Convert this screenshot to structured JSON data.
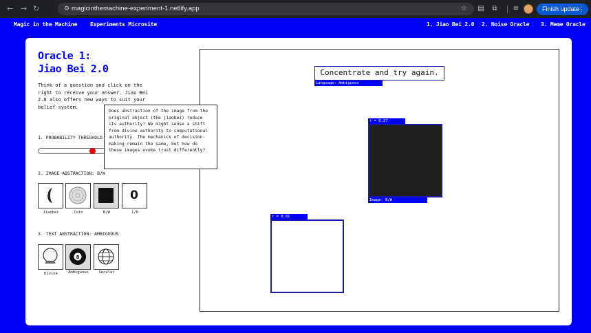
{
  "browser": {
    "url": "magicinthemachine-experiment-1.netlify.app",
    "update_button": "Finish update"
  },
  "site": {
    "brand": "Magic in the Machine",
    "subtitle": "Experiments Microsite",
    "nav": [
      "1. Jiao Bei 2.0",
      "2. Noise Oracle",
      "3. Meme Oracle"
    ]
  },
  "sidebar": {
    "title_line1": "Oracle 1:",
    "title_line2": "Jiao Bei 2.0",
    "intro": "Think of a question and click on the right to receive your answer. Jiao Bei 2.0 also offers new ways to suit your belief system.",
    "probability_label": "1. PROBABILITY THRESHOLD",
    "image_label": "2. IMAGE ABSTRACTION: B/W",
    "image_options": [
      "Jiaobei",
      "Coin",
      "B/W",
      "1/0"
    ],
    "image_option_glyph": "0",
    "text_label": "3. TEXT ABSTRACTION: AMBIGUOUS",
    "text_options": [
      "Divine",
      "Ambiguous",
      "Secular"
    ],
    "tooltip": "Does abstraction of the image from the original object (the jiaobei) reduce its authority? We might sense a shift from divine authority to computational authority. The mechanics of decision-making remain the same, but how do these images evoke trust differently?",
    "slider_value": 0.73
  },
  "stage": {
    "answer": "Concentrate and try again.",
    "language_tag": "Language: Ambiguous",
    "block1_r": "r = 0.27",
    "block1_caption": "Image: B/W",
    "block2_r": "r = 0.81"
  },
  "colors": {
    "brand_blue": "#0000f7",
    "slider_thumb": "#e8000b",
    "browser_accent": "#0b57d0"
  }
}
